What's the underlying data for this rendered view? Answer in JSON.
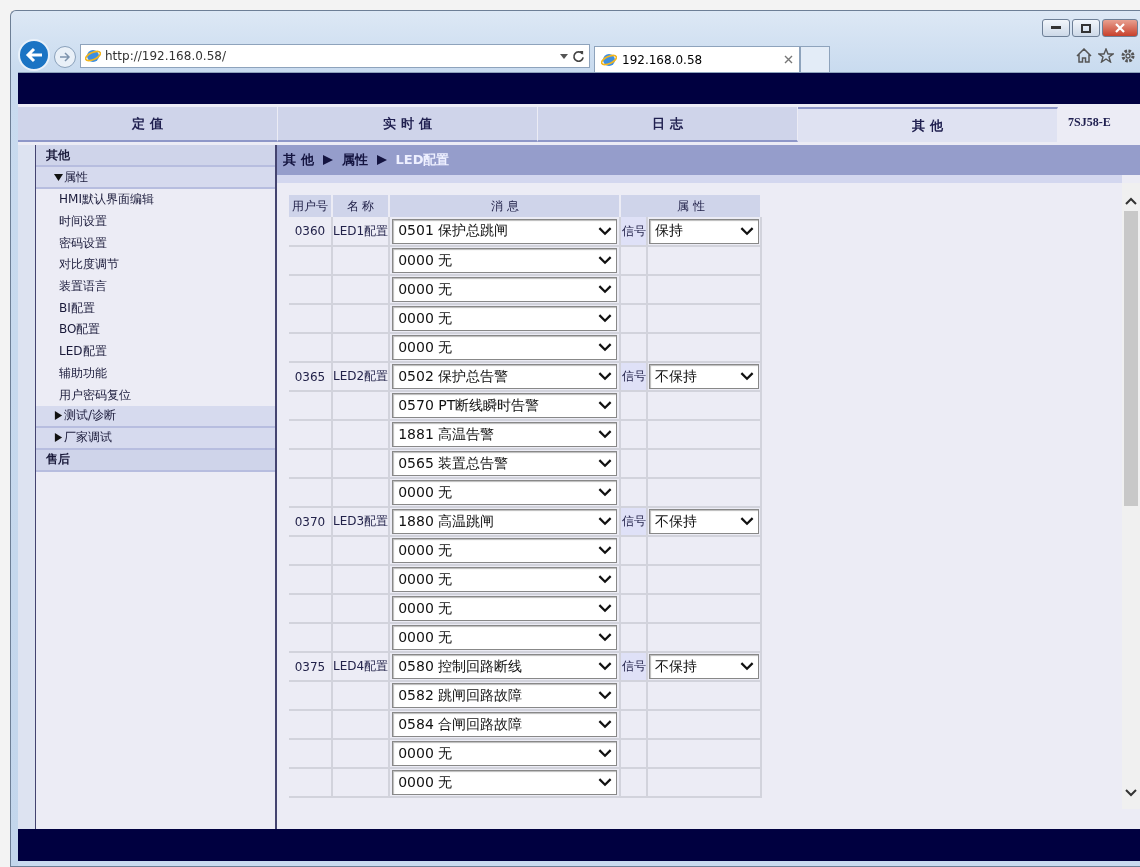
{
  "browser": {
    "address": "http://192.168.0.58/",
    "tab_title": "192.168.0.58"
  },
  "tabs": [
    {
      "label": "定 值",
      "selected": false
    },
    {
      "label": "实 时 值",
      "selected": false
    },
    {
      "label": "日 志",
      "selected": false
    },
    {
      "label": "其 他",
      "selected": true
    }
  ],
  "model": "7SJ58-E",
  "sidebar": {
    "items": [
      {
        "kind": "section",
        "label": "其他",
        "children": [
          {
            "kind": "group",
            "label": "属性",
            "expanded": true,
            "children": [
              {
                "kind": "item",
                "label": "HMI默认界面编辑"
              },
              {
                "kind": "item",
                "label": "时间设置"
              },
              {
                "kind": "item",
                "label": "密码设置"
              },
              {
                "kind": "item",
                "label": "对比度调节"
              },
              {
                "kind": "item",
                "label": "装置语言"
              },
              {
                "kind": "item",
                "label": "BI配置"
              },
              {
                "kind": "item",
                "label": "BO配置"
              },
              {
                "kind": "item",
                "label": "LED配置"
              },
              {
                "kind": "item",
                "label": "辅助功能"
              },
              {
                "kind": "item",
                "label": "用户密码复位"
              }
            ]
          },
          {
            "kind": "group",
            "label": "测试/诊断",
            "expanded": false
          },
          {
            "kind": "group",
            "label": "厂家调试",
            "expanded": false
          }
        ]
      },
      {
        "kind": "section",
        "label": "售后"
      }
    ]
  },
  "breadcrumb": [
    "其 他",
    "属性",
    "LED配置"
  ],
  "table": {
    "columns": [
      "用户号",
      "名 称",
      "消 息",
      "属 性"
    ],
    "leds": [
      {
        "user_no": "0360",
        "name": "LED1配置",
        "signal": "信号",
        "hold": "保持",
        "messages": [
          "0501 保护总跳闸",
          "0000 无",
          "0000 无",
          "0000 无",
          "0000 无"
        ]
      },
      {
        "user_no": "0365",
        "name": "LED2配置",
        "signal": "信号",
        "hold": "不保持",
        "messages": [
          "0502 保护总告警",
          "0570 PT断线瞬时告警",
          "1881 高温告警",
          "0565 装置总告警",
          "0000 无"
        ]
      },
      {
        "user_no": "0370",
        "name": "LED3配置",
        "signal": "信号",
        "hold": "不保持",
        "messages": [
          "1880 高温跳闸",
          "0000 无",
          "0000 无",
          "0000 无",
          "0000 无"
        ]
      },
      {
        "user_no": "0375",
        "name": "LED4配置",
        "signal": "信号",
        "hold": "不保持",
        "messages": [
          "0580 控制回路断线",
          "0582 跳闸回路故障",
          "0584 合闸回路故障",
          "0000 无",
          "0000 无"
        ]
      }
    ]
  }
}
